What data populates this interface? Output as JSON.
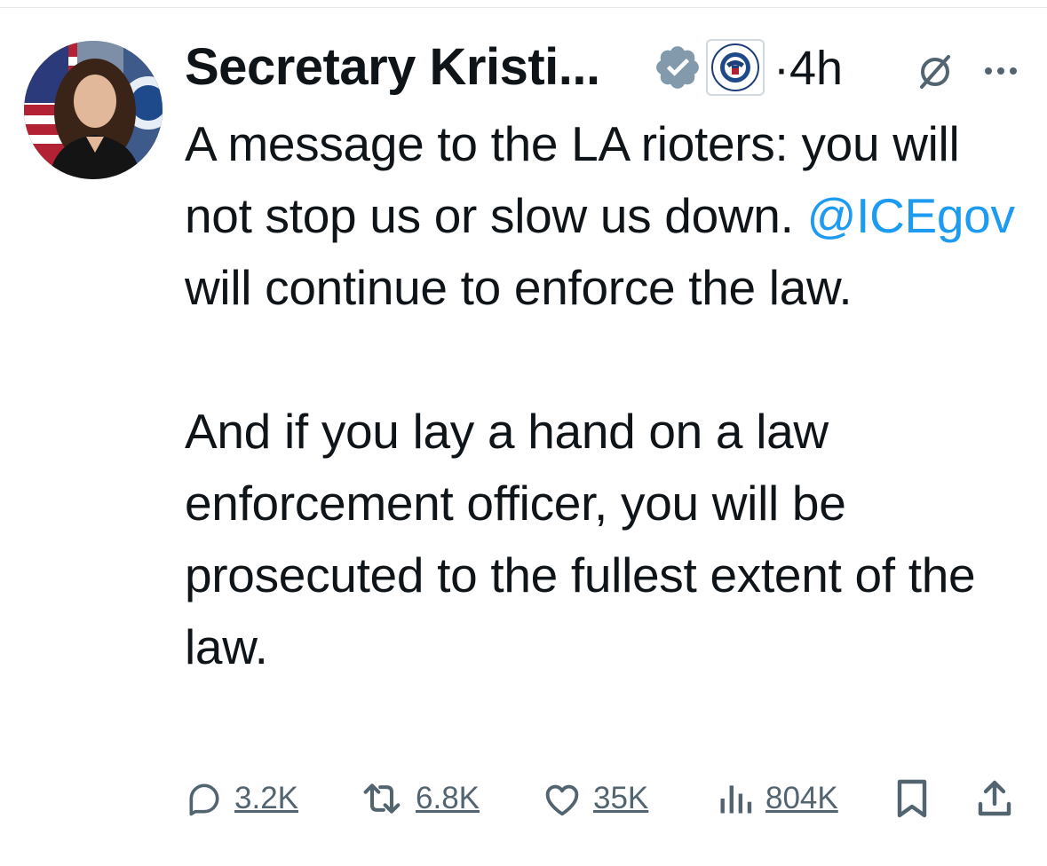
{
  "tweet": {
    "author": {
      "display_name": "Secretary Kristi...",
      "verified_badge": "verified-check-icon",
      "affiliation_badge": "dhs-seal-icon"
    },
    "timestamp": "·4h",
    "paragraph1_before_mention": "A message to the LA rioters: you will not stop us or slow us down. ",
    "mention": "@ICEgov",
    "paragraph1_after_mention": " will continue to enforce the law.",
    "paragraph2": "And if you lay a hand on a law enforcement officer, you will be prosecuted to the fullest extent of the law."
  },
  "actions": {
    "replies": "3.2K",
    "reposts": "6.8K",
    "likes": "35K",
    "views": "804K"
  },
  "icons": {
    "header": [
      "grok-icon",
      "more-icon"
    ],
    "actions": [
      "reply-icon",
      "repost-icon",
      "like-icon",
      "views-icon",
      "bookmark-icon",
      "share-icon"
    ]
  },
  "colors": {
    "text": "#0f1419",
    "secondary": "#536471",
    "mention": "#1d9bf0",
    "verified_badge": "#829aab"
  }
}
